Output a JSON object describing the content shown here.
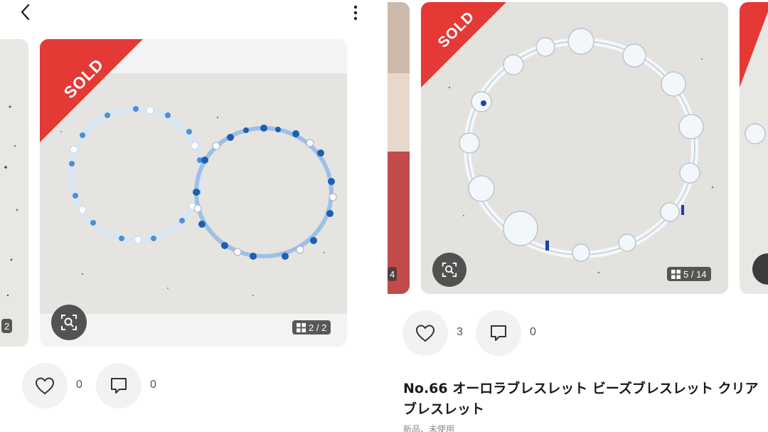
{
  "colors": {
    "sold_red": "#e53935",
    "overlay_dark": "#3c3c3c",
    "action_bg": "#f2f2f2",
    "photo_bg": "#e9e7e3"
  },
  "icons": {
    "back": "chevron-left-icon",
    "more": "vertical-dots-icon",
    "lens": "image-search-icon",
    "gallery": "grid-icon",
    "like": "heart-icon",
    "comment": "speech-bubble-icon"
  },
  "left_listing": {
    "sold_label": "SOLD",
    "image_counter": "2 / 2",
    "prev_counter_fragment": "2",
    "like_count": "0",
    "comment_count": "0"
  },
  "right_listing": {
    "sold_label": "SOLD",
    "image_counter": "5 / 14",
    "prev_counter_fragment": "4",
    "like_count": "3",
    "comment_count": "0",
    "title": "No.66 オーロラブレスレット ビーズブレスレット クリアブレスレット",
    "subtext": "新品、未使用"
  }
}
